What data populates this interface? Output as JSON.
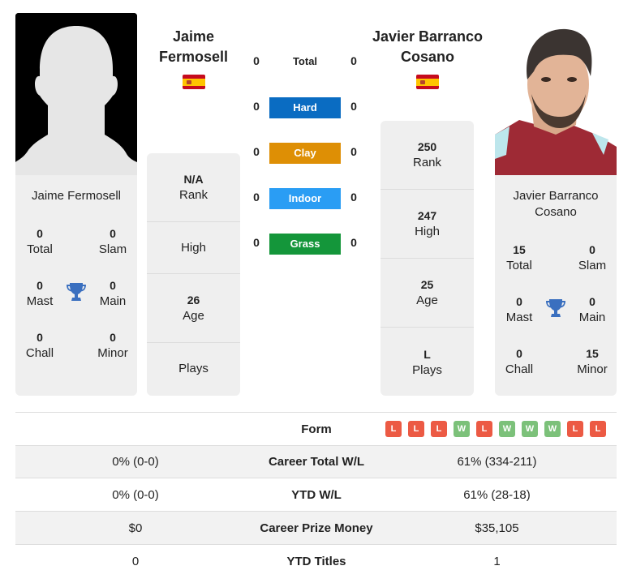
{
  "colors": {
    "hard": "#0a6cc2",
    "clay": "#de8f05",
    "indoor": "#2a9df4",
    "grass": "#14963a",
    "win": "#7cc17a",
    "loss": "#ec5a44",
    "trophy": "#3a6fbf"
  },
  "player1": {
    "header_name_line1": "Jaime",
    "header_name_line2": "Fermosell",
    "country_flag": "spain-flag",
    "card_name": "Jaime Fermosell",
    "photo": "silhouette-placeholder",
    "titles": {
      "total": {
        "value": "0",
        "label": "Total"
      },
      "slam": {
        "value": "0",
        "label": "Slam"
      },
      "mast": {
        "value": "0",
        "label": "Mast"
      },
      "main": {
        "value": "0",
        "label": "Main"
      },
      "chall": {
        "value": "0",
        "label": "Chall"
      },
      "minor": {
        "value": "0",
        "label": "Minor"
      }
    },
    "stats": [
      {
        "value": "N/A",
        "label": "Rank"
      },
      {
        "value": "",
        "label": "High"
      },
      {
        "value": "26",
        "label": "Age"
      },
      {
        "value": "",
        "label": "Plays"
      }
    ]
  },
  "player2": {
    "header_name_line1": "Javier Barranco",
    "header_name_line2": "Cosano",
    "country_flag": "spain-flag",
    "card_name_line1": "Javier Barranco",
    "card_name_line2": "Cosano",
    "photo": "player-photo",
    "titles": {
      "total": {
        "value": "15",
        "label": "Total"
      },
      "slam": {
        "value": "0",
        "label": "Slam"
      },
      "mast": {
        "value": "0",
        "label": "Mast"
      },
      "main": {
        "value": "0",
        "label": "Main"
      },
      "chall": {
        "value": "0",
        "label": "Chall"
      },
      "minor": {
        "value": "15",
        "label": "Minor"
      }
    },
    "stats": [
      {
        "value": "250",
        "label": "Rank"
      },
      {
        "value": "247",
        "label": "High"
      },
      {
        "value": "25",
        "label": "Age"
      },
      {
        "value": "L",
        "label": "Plays"
      }
    ]
  },
  "h2h": [
    {
      "label": "Total",
      "p1": "0",
      "p2": "0"
    },
    {
      "label": "Hard",
      "p1": "0",
      "p2": "0"
    },
    {
      "label": "Clay",
      "p1": "0",
      "p2": "0"
    },
    {
      "label": "Indoor",
      "p1": "0",
      "p2": "0"
    },
    {
      "label": "Grass",
      "p1": "0",
      "p2": "0"
    }
  ],
  "comparison": {
    "form_label": "Form",
    "form_p2": [
      "L",
      "L",
      "L",
      "W",
      "L",
      "W",
      "W",
      "W",
      "L",
      "L"
    ],
    "rows": [
      {
        "p1": "0% (0-0)",
        "label": "Career Total W/L",
        "p2": "61% (334-211)"
      },
      {
        "p1": "0% (0-0)",
        "label": "YTD W/L",
        "p2": "61% (28-18)"
      },
      {
        "p1": "$0",
        "label": "Career Prize Money",
        "p2": "$35,105"
      },
      {
        "p1": "0",
        "label": "YTD Titles",
        "p2": "1"
      }
    ]
  }
}
